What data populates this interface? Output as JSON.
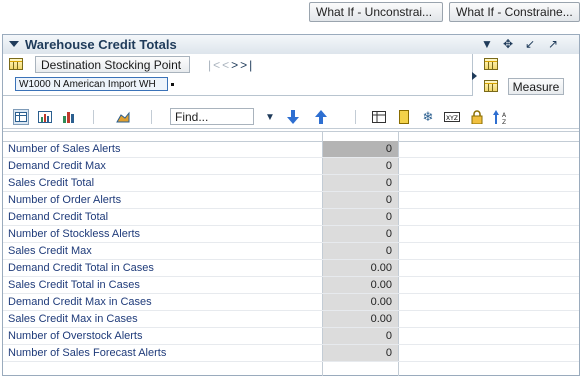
{
  "top_buttons": [
    {
      "label": "What If - Unconstrai..."
    },
    {
      "label": "What If - Constraine..."
    }
  ],
  "panel": {
    "title": "Warehouse Credit Totals",
    "header_icons": [
      "dropdown-arrow-icon",
      "move-icon",
      "minimize-icon",
      "maximize-icon"
    ]
  },
  "pivot": {
    "dimension_label": "Destination Stocking Point",
    "member": "W1000 N American Import WH",
    "nav": [
      "|<",
      "<",
      ">",
      ">|"
    ],
    "measure_label": "Measure"
  },
  "toolbar": {
    "find_placeholder": "Find...",
    "icons": [
      "table-view-icon",
      "chart-table-icon",
      "chart-icon",
      "area-chart-icon",
      "find-dropdown-icon",
      "move-down-icon",
      "move-up-icon",
      "column-select-icon",
      "freeze-icon",
      "snowflake-icon",
      "xyz-icon",
      "lock-icon",
      "sort-icon"
    ]
  },
  "rows": [
    {
      "label": "Number of Sales Alerts",
      "value": "0"
    },
    {
      "label": "Demand Credit Max",
      "value": "0"
    },
    {
      "label": "Sales Credit Total",
      "value": "0"
    },
    {
      "label": "Number of Order Alerts",
      "value": "0"
    },
    {
      "label": "Demand Credit Total",
      "value": "0"
    },
    {
      "label": "Number of Stockless Alerts",
      "value": "0"
    },
    {
      "label": "Sales Credit Max",
      "value": "0"
    },
    {
      "label": "Demand Credit Total in Cases",
      "value": "0.00"
    },
    {
      "label": "Sales Credit Total in Cases",
      "value": "0.00"
    },
    {
      "label": "Demand Credit Max in Cases",
      "value": "0.00"
    },
    {
      "label": "Sales Credit Max in Cases",
      "value": "0.00"
    },
    {
      "label": "Number of Overstock Alerts",
      "value": "0"
    },
    {
      "label": "Number of Sales Forecast Alerts",
      "value": "0"
    }
  ]
}
